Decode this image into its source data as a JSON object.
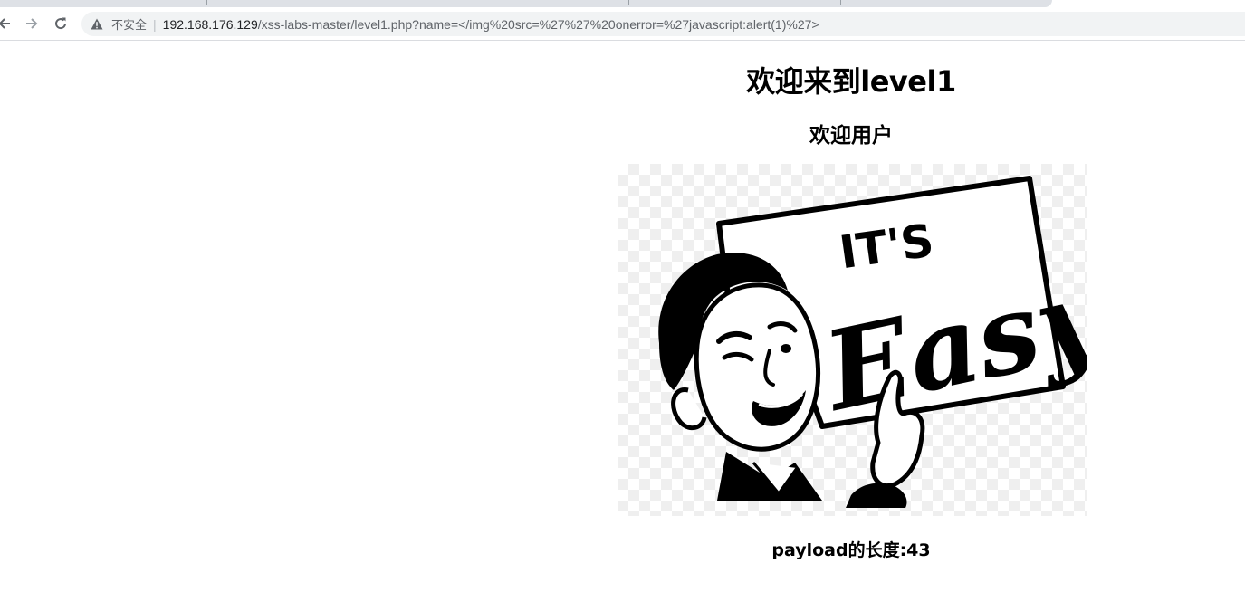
{
  "browser": {
    "security_label": "不安全",
    "url_host": "192.168.176.129",
    "url_path": "/xss-labs-master/level1.php?name=</img%20src=%27%27%20onerror=%27javascript:alert(1)%27>",
    "icons": {
      "back": "back-arrow-icon",
      "forward": "forward-arrow-icon",
      "reload": "reload-icon",
      "warning": "warning-triangle-icon"
    }
  },
  "page": {
    "heading": "欢迎来到level1",
    "subheading": "欢迎用户",
    "image": {
      "sign_top_text": "IT'S",
      "sign_script_text": "Easy"
    },
    "payload_label": "payload的长度:43"
  }
}
